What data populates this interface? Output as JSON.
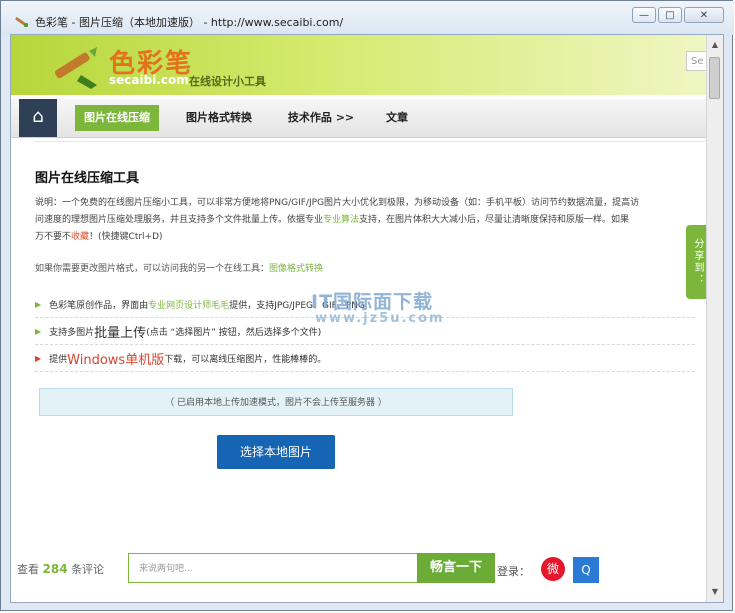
{
  "window": {
    "title": "色彩笔 - 图片压缩（本地加速版） - http://www.secaibi.com/",
    "controls": {
      "minimize": "—",
      "maximize": "□",
      "close": "✕"
    }
  },
  "header": {
    "logo_cn": "色彩笔",
    "logo_en": "secaibi.com",
    "slogan": "在线设计小工具",
    "search_placeholder": "Se"
  },
  "nav": {
    "home_icon": "⌂",
    "items": [
      {
        "label": "图片在线压缩",
        "active": true
      },
      {
        "label": "图片格式转换"
      },
      {
        "label": "技术作品 >>"
      },
      {
        "label": "文章"
      }
    ]
  },
  "main": {
    "title": "图片在线压缩工具",
    "intro_1": "说明：一个免费的在线图片压缩小工具，可以非常方便地将PNG/GIF/JPG图片大小优化到极限，为移动设备（如：手机平板）访问节约数据流量，提高访",
    "intro_2a": "问速度的理想图片压缩处理服务，并且支持多个文件批量上传。依据专业",
    "intro_2_link": "专业算法",
    "intro_2b": "支持，在图片体积大大减小后，尽量让清晰度保持和原版一样。如果",
    "intro_3a": "万不要不",
    "intro_3_link": "收藏",
    "intro_3b": "！(快捷键Ctrl+D)",
    "recommend_text": "如果你需要更改图片格式，可以访问我的另一个在线工具：",
    "recommend_link": "图像格式转换",
    "features": [
      {
        "pre": "色彩笔原创作品，界面由",
        "link": "专业网页设计师毛毛",
        "post": "提供，支持JPG/JPEG、GIF、PNG"
      },
      {
        "pre": "支持多图片",
        "big": "批量上传",
        "post": "(点击 “选择图片” 按钮，然后选择多个文件)"
      },
      {
        "pre": "提供",
        "big": "Windows单机版",
        "post": "下载，可以离线压缩图片，性能棒棒的。"
      }
    ],
    "notice": "（ 已启用本地上传加速模式，图片不会上传至服务器 ）",
    "select_button": "选择本地图片"
  },
  "share_tab": "分享到：",
  "watermark": {
    "main": "IT国际面下载",
    "sub": "www.jz5u.com"
  },
  "comment_bar": {
    "count_pre": "查看",
    "count_num": "284",
    "count_post": "条评论",
    "input_placeholder": "来说两句吧...",
    "submit": "畅言一下",
    "login_label": "登录：",
    "weibo_icon": "微",
    "qq_icon": "Q"
  }
}
